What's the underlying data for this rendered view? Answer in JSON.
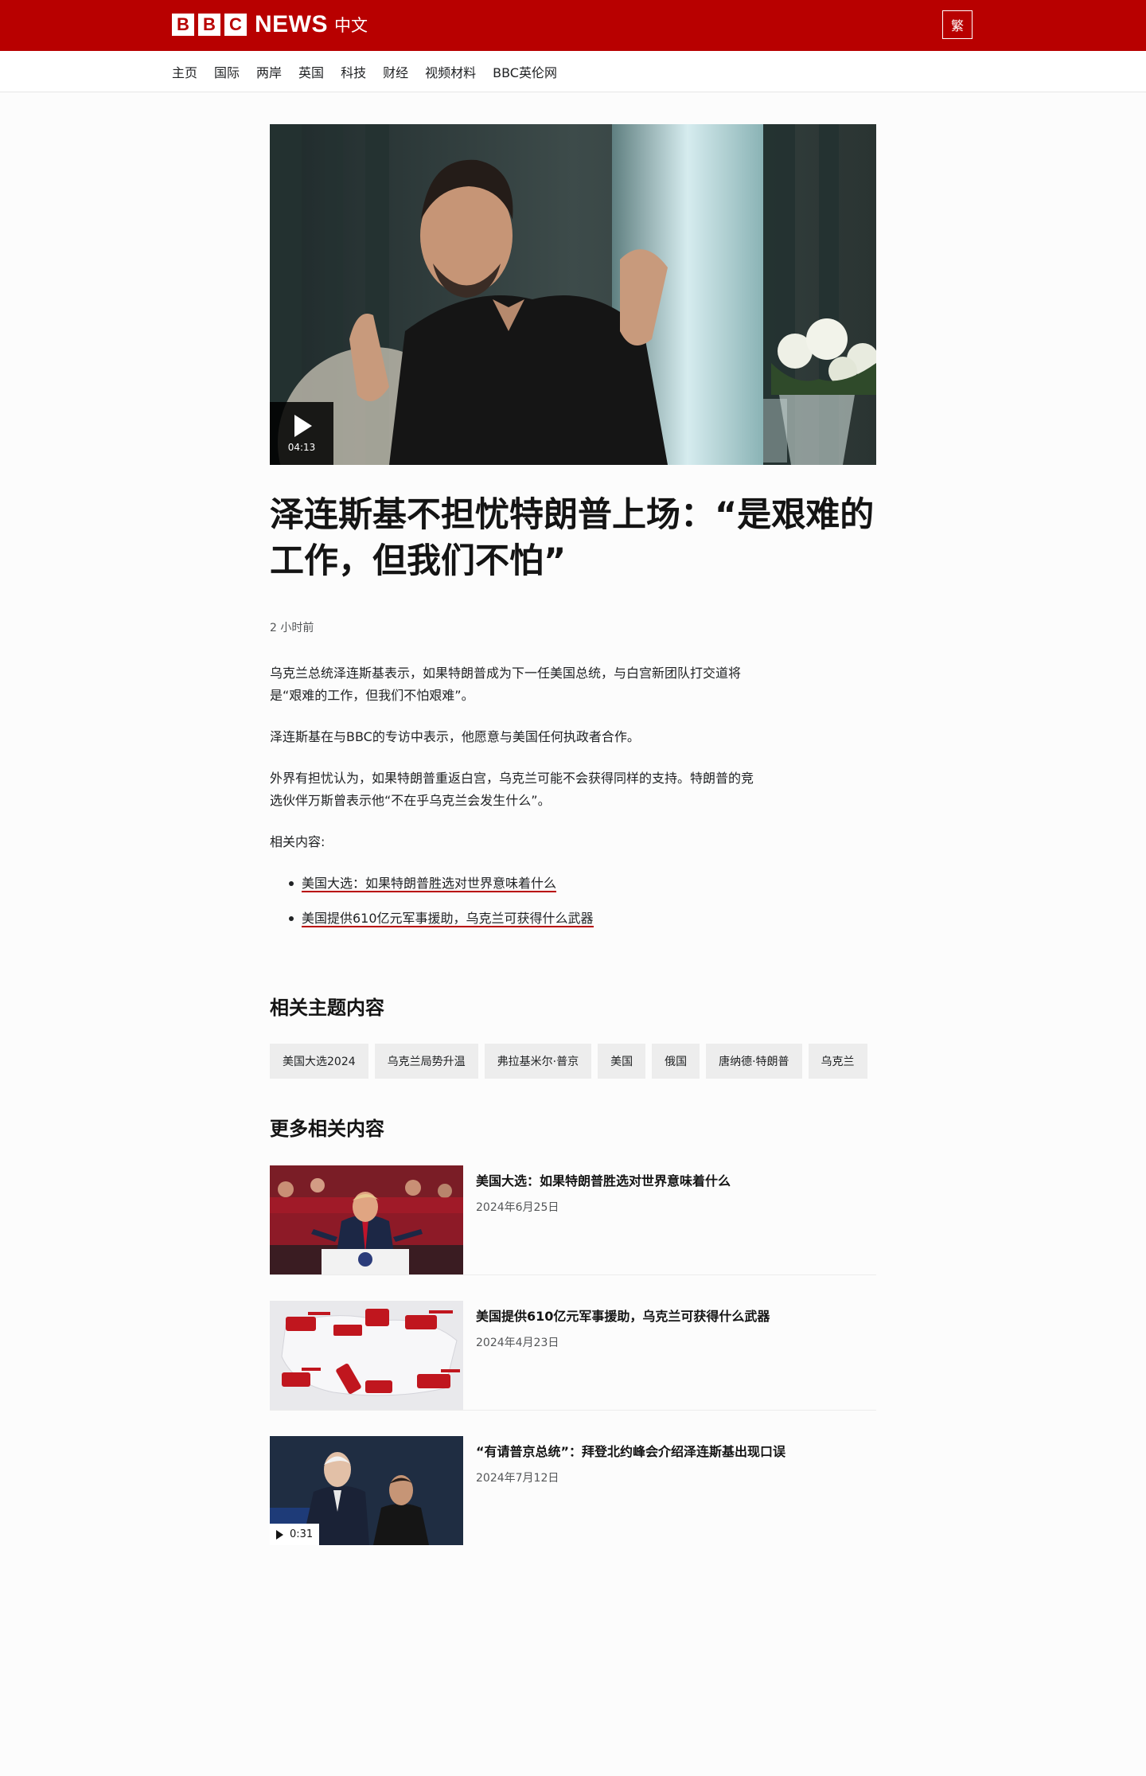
{
  "brand": {
    "letters": [
      "B",
      "B",
      "C"
    ],
    "news": "NEWS",
    "lang": "中文",
    "lang_toggle": "繁"
  },
  "nav": [
    "主页",
    "国际",
    "两岸",
    "英国",
    "科技",
    "财经",
    "视频材料",
    "BBC英伦网"
  ],
  "hero": {
    "duration": "04:13"
  },
  "article": {
    "headline": "泽连斯基不担忧特朗普上场：“是艰难的工作，但我们不怕”",
    "timestamp": "2 小时前",
    "paragraphs": [
      "乌克兰总统泽连斯基表示，如果特朗普成为下一任美国总统，与白宫新团队打交道将是“艰难的工作，但我们不怕艰难”。",
      "泽连斯基在与BBC的专访中表示，他愿意与美国任何执政者合作。",
      "外界有担忧认为，如果特朗普重返白宫，乌克兰可能不会获得同样的支持。特朗普的竞选伙伴万斯曾表示他“不在乎乌克兰会发生什么”。",
      "相关内容:"
    ],
    "related_links": [
      "美国大选：如果特朗普胜选对世界意味着什么",
      "美国提供610亿元军事援助，乌克兰可获得什么武器"
    ]
  },
  "topics": {
    "heading": "相关主题内容",
    "items": [
      "美国大选2024",
      "乌克兰局势升温",
      "弗拉基米尔·普京",
      "美国",
      "俄国",
      "唐纳德·特朗普",
      "乌克兰"
    ]
  },
  "more": {
    "heading": "更多相关内容",
    "cards": [
      {
        "title": "美国大选：如果特朗普胜选对世界意味着什么",
        "date": "2024年6月25日"
      },
      {
        "title": "美国提供610亿元军事援助，乌克兰可获得什么武器",
        "date": "2024年4月23日"
      },
      {
        "title": "“有请普京总统”：拜登北约峰会介绍泽连斯基出现口误",
        "date": "2024年7月12日",
        "duration": "0:31"
      }
    ]
  },
  "colors": {
    "brand_red": "#b80000",
    "text": "#141414",
    "muted": "#545658"
  }
}
